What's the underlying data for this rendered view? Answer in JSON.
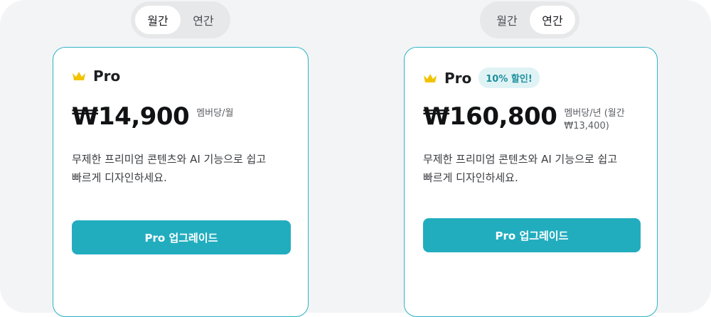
{
  "cards": [
    {
      "toggle": {
        "monthly_label": "월간",
        "yearly_label": "연간",
        "active": "monthly"
      },
      "plan_name": "Pro",
      "badge": "",
      "price": "₩14,900",
      "unit": "멤버당/월",
      "unit_line2": "",
      "description_line1": "무제한 프리미엄 콘텐츠와 AI 기능으로 쉽고",
      "description_line2": "빠르게 디자인하세요.",
      "cta_label": "Pro 업그레이드"
    },
    {
      "toggle": {
        "monthly_label": "월간",
        "yearly_label": "연간",
        "active": "yearly"
      },
      "plan_name": "Pro",
      "badge": "10% 할인!",
      "price": "₩160,800",
      "unit": "멤버당/년 (월간",
      "unit_line2": "₩13,400)",
      "description_line1": "무제한 프리미엄 콘텐츠와 AI 기능으로 쉽고",
      "description_line2": "빠르게 디자인하세요.",
      "cta_label": "Pro 업그레이드"
    }
  ],
  "colors": {
    "accent": "#22adbf",
    "card_border": "#2eb3c2",
    "crown": "#f2c300",
    "badge_bg": "#dff3f5",
    "badge_text": "#1f8f9d",
    "background": "#f3f4f6"
  },
  "icons": {
    "plan_icon": "crown-icon"
  }
}
